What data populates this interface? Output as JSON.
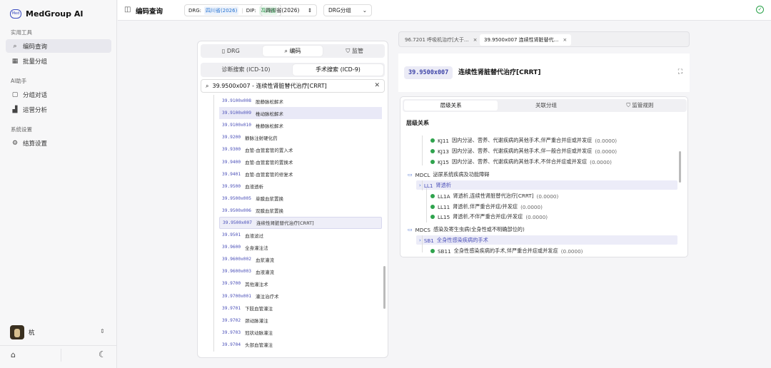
{
  "app": {
    "name": "MedGroup AI",
    "logo_text": "Med"
  },
  "sidebar": {
    "sections": [
      {
        "title": "实用工具",
        "items": [
          {
            "label": "编码查询",
            "icon": "search-icon",
            "active": true
          },
          {
            "label": "批量分组",
            "icon": "grid-icon"
          }
        ]
      },
      {
        "title": "AI助手",
        "items": [
          {
            "label": "分组对话",
            "icon": "chat-icon"
          },
          {
            "label": "运营分析",
            "icon": "bar-chart-icon"
          }
        ]
      },
      {
        "title": "系统设置",
        "items": [
          {
            "label": "结算设置",
            "icon": "gear-icon"
          }
        ]
      }
    ],
    "user": {
      "name": "杭"
    }
  },
  "topbar": {
    "title": "编码查询",
    "drg_label": "DRG:",
    "drg_value": "四川省(2026)",
    "divider": "|",
    "dip_label": "DIP:",
    "dip_value": "四川省",
    "select_region": "四川省(2026)",
    "select_group": "DRG分组"
  },
  "left": {
    "tabs": [
      "DRG",
      "编码",
      "监管"
    ],
    "active_tab": "编码",
    "search_tabs": [
      "诊断搜索 (ICD-10)",
      "手术搜索 (ICD-9)"
    ],
    "active_search_tab": "手术搜索 (ICD-9)",
    "search_value": "39.9500x007 - 连续性肾脏替代治疗[CRRT]",
    "items": [
      {
        "code": "39.9100x008",
        "name": "股静脉松解术"
      },
      {
        "code": "39.9100x009",
        "name": "椎动脉松解术",
        "state": "hover"
      },
      {
        "code": "39.9100x010",
        "name": "椎静脉松解术"
      },
      {
        "code": "39.9200",
        "name": "静脉注射硬化药"
      },
      {
        "code": "39.9300",
        "name": "血管-血管套管的置入术"
      },
      {
        "code": "39.9400",
        "name": "血管-血管套管的置换术"
      },
      {
        "code": "39.9401",
        "name": "血管-血管套管的修复术"
      },
      {
        "code": "39.9500",
        "name": "血液透析"
      },
      {
        "code": "39.9500x005",
        "name": "单膜血浆置换"
      },
      {
        "code": "39.9500x006",
        "name": "双膜血浆置换"
      },
      {
        "code": "39.9500x007",
        "name": "连续性肾脏替代治疗[CRRT]",
        "state": "selected"
      },
      {
        "code": "39.9501",
        "name": "血液滤过"
      },
      {
        "code": "39.9600",
        "name": "全身灌注法"
      },
      {
        "code": "39.9600x002",
        "name": "血浆灌流"
      },
      {
        "code": "39.9600x003",
        "name": "血液灌流"
      },
      {
        "code": "39.9700",
        "name": "其他灌注术"
      },
      {
        "code": "39.9700x001",
        "name": "灌注治疗术"
      },
      {
        "code": "39.9701",
        "name": "下肢血管灌注"
      },
      {
        "code": "39.9702",
        "name": "颈动脉灌注"
      },
      {
        "code": "39.9703",
        "name": "冠状动脉灌注"
      },
      {
        "code": "39.9704",
        "name": "头部血管灌注"
      }
    ]
  },
  "right": {
    "open_tabs": [
      "96.7201 呼吸机治疗[大于...",
      "39.9500x007 连续性肾脏替代..."
    ],
    "close_glyph": "×",
    "header": {
      "code": "39.9500x007",
      "name": "连续性肾脏替代治疗[CRRT]"
    },
    "detail_tabs": [
      "层级关系",
      "关联分组",
      "监管规则"
    ],
    "section_title": "层级关系",
    "tree": [
      {
        "type": "leaf",
        "code": "KJ11",
        "text": "因内分泌、营养、代谢疾病的其他手术,伴严重合并症或并发症",
        "score": "(0.0000)"
      },
      {
        "type": "leaf",
        "code": "KJ13",
        "text": "因内分泌、营养、代谢疾病的其他手术,伴一般合并症或并发症",
        "score": "(0.0000)"
      },
      {
        "type": "leaf",
        "code": "KJ15",
        "text": "因内分泌、营养、代谢疾病的其他手术,不伴合并症或并发症",
        "score": "(0.0000)"
      },
      {
        "type": "mdc",
        "code": "MDCL",
        "text": "泌尿系统疾病及功能障碍"
      },
      {
        "type": "adrg",
        "code": "LL1",
        "text": "肾透析"
      },
      {
        "type": "leaf",
        "code": "LL1A",
        "text": "肾透析,连续性肾脏替代治疗[CRRT]",
        "score": "(0.0000)"
      },
      {
        "type": "leaf",
        "code": "LL11",
        "text": "肾透析,伴严重合并症/并发症",
        "score": "(0.0000)"
      },
      {
        "type": "leaf",
        "code": "LL15",
        "text": "肾透析,不伴严重合并症/并发症",
        "score": "(0.0000)"
      },
      {
        "type": "mdc",
        "code": "MDCS",
        "text": "感染及寄生虫病(全身性或不明确部位的)"
      },
      {
        "type": "adrg",
        "code": "SB1",
        "text": "全身性感染疾病的手术"
      },
      {
        "type": "leaf",
        "code": "SB11",
        "text": "全身性感染疾病的手术,伴严重合并症或并发症",
        "score": "(0.0000)"
      }
    ]
  },
  "colors": {
    "accent": "#4a4fb8",
    "ok": "#2aa24a",
    "drg": "#1f6fd0",
    "dip": "#178a3a"
  }
}
